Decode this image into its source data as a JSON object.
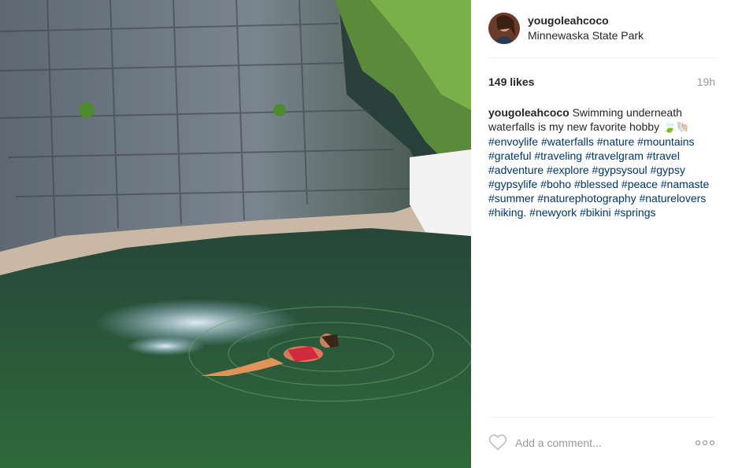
{
  "post": {
    "username": "yougoleahcoco",
    "location": "Minnewaska State Park",
    "likes": "149 likes",
    "time_ago": "19h",
    "caption": {
      "username": "yougoleahcoco",
      "text": "Swimming underneath waterfalls is my new favorite hobby",
      "emoji": "🍃🐚",
      "hashtags": [
        "#envoylife",
        "#waterfalls",
        "#nature",
        "#mountains",
        "#grateful",
        "#traveling",
        "#travelgram",
        "#travel",
        "#adventure",
        "#explore",
        "#gypsysoul",
        "#gypsy",
        "#gypsylife",
        "#boho",
        "#blessed",
        "#peace",
        "#namaste",
        "#summer",
        "#naturephotography",
        "#naturelovers",
        "#hiking.",
        "#newyork",
        "#bikini",
        "#springs"
      ]
    }
  },
  "comment": {
    "placeholder": "Add a comment..."
  },
  "icons": {
    "like": "heart-icon",
    "more": "more-options-icon"
  },
  "colors": {
    "hashtag": "#003569",
    "divider": "#efefef",
    "muted": "#999999"
  }
}
